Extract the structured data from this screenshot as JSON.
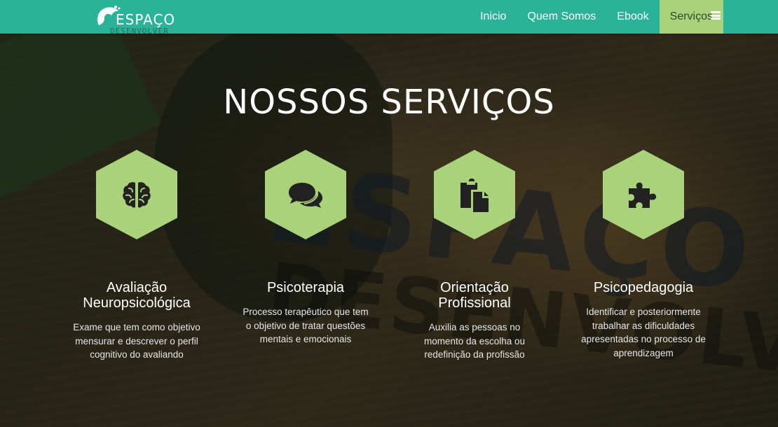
{
  "brand": {
    "name": "ESPAÇO",
    "subtitle": "DESENVOLVER"
  },
  "nav": {
    "items": [
      {
        "label": "Inicio"
      },
      {
        "label": "Quem Somos"
      },
      {
        "label": "Ebook"
      },
      {
        "label": "Serviços",
        "active": true
      }
    ],
    "menu_icon": "hamburger-icon"
  },
  "page": {
    "title": "NOSSOS SERVIÇOS"
  },
  "services": [
    {
      "icon": "brain-icon",
      "title": "Avaliação Neuropsicológica",
      "description": "Exame que tem como objetivo mensurar e descrever o perfil cognitivo do avaliando"
    },
    {
      "icon": "chat-bubbles-icon",
      "title": "Psicoterapia",
      "description": "Processo terapêutico que tem o objetivo de tratar questões mentais e emocionais"
    },
    {
      "icon": "clipboard-icon",
      "title": "Orientação Profissional",
      "description": "Auxilia as pessoas no momento da escolha ou redefinição da profissão"
    },
    {
      "icon": "puzzle-icon",
      "title": "Psicopedagogia",
      "description": "Identificar e posteriormente trabalhar as dificuldades apresentadas no processo de aprendizagem"
    }
  ],
  "colors": {
    "navbar": "#2bb39a",
    "accent": "#a9d27a",
    "icon": "#222222"
  }
}
